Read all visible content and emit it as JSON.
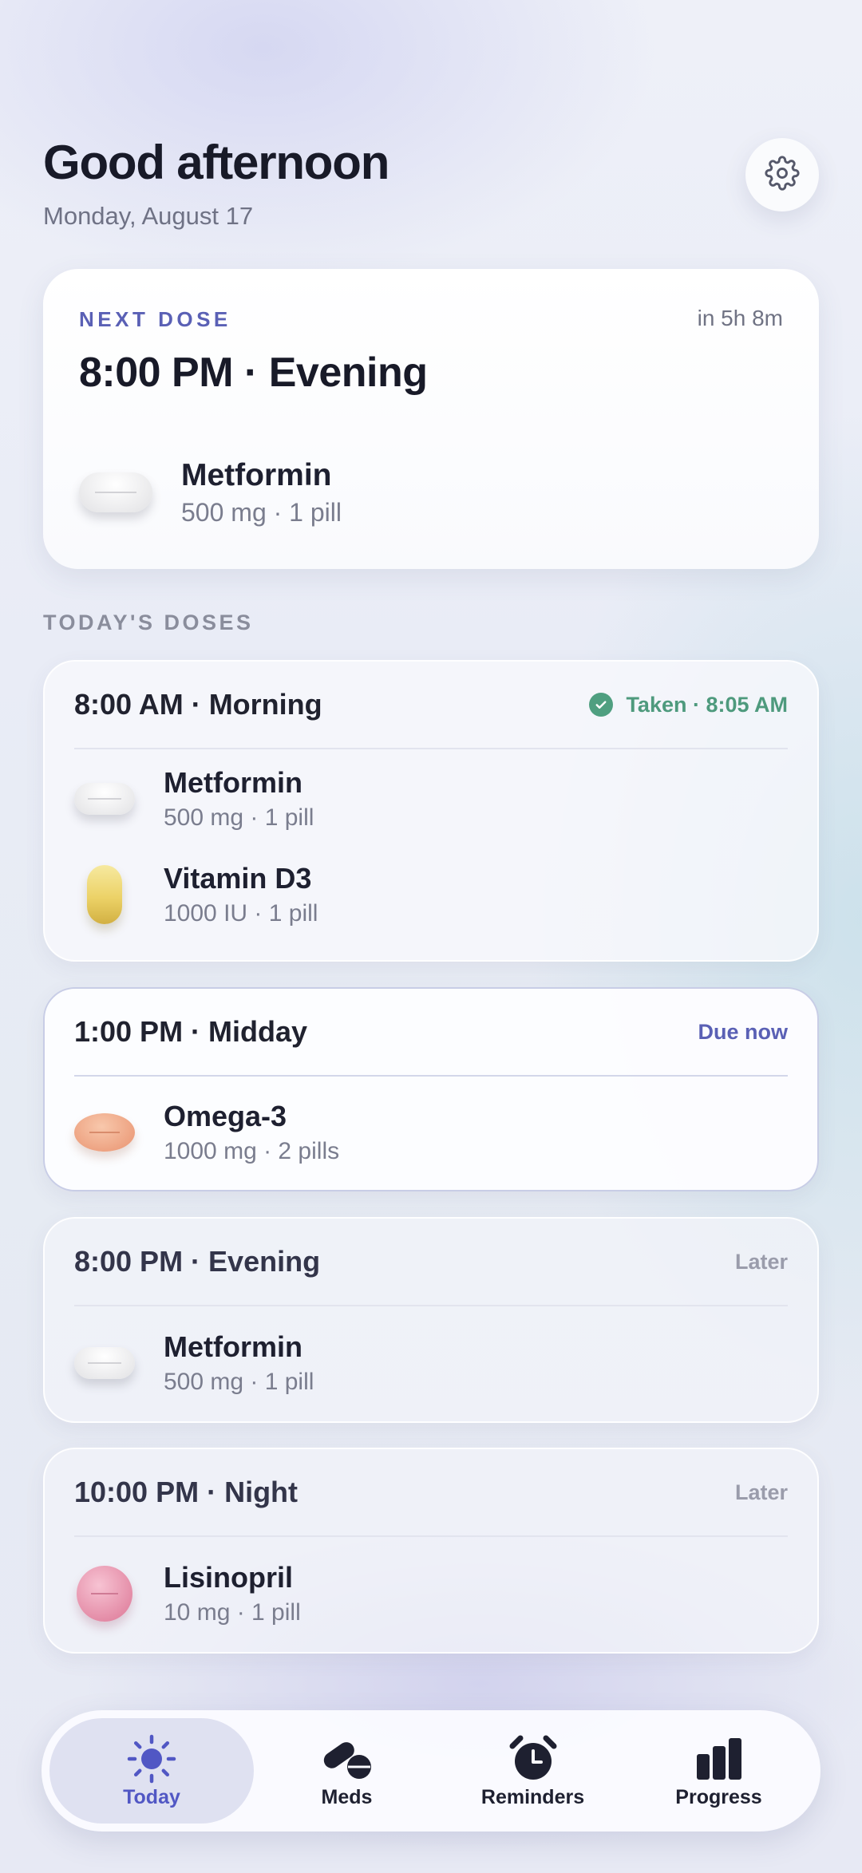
{
  "header": {
    "greeting": "Good afternoon",
    "date": "Monday, August 17"
  },
  "settings": {
    "icon": "gear-icon"
  },
  "next_dose": {
    "label": "NEXT DOSE",
    "eta": "in 5h 8m",
    "time": "8:00 PM · Evening",
    "med": {
      "name": "Metformin",
      "detail": "500 mg · 1 pill",
      "pill": "white-oval-pill"
    }
  },
  "section_title": "TODAY'S DOSES",
  "doses": [
    {
      "time": "8:00 AM · Morning",
      "status": "Taken · 8:05 AM",
      "status_color": "#4e9a7d",
      "meds": [
        {
          "name": "Metformin",
          "detail": "500 mg · 1 pill",
          "pill": "white-oval-pill"
        },
        {
          "name": "Vitamin D3",
          "detail": "1000 IU · 1 pill",
          "pill": "yellow-capsule"
        }
      ]
    },
    {
      "time": "1:00 PM · Midday",
      "status": "Due now",
      "status_color": "#5a60b5",
      "meds": [
        {
          "name": "Omega-3",
          "detail": "1000 mg · 2 pills",
          "pill": "orange-oval-pill"
        }
      ]
    },
    {
      "time": "8:00 PM · Evening",
      "status": "Later",
      "meds": [
        {
          "name": "Metformin",
          "detail": "500 mg · 1 pill",
          "pill": "white-oval-pill"
        }
      ]
    },
    {
      "time": "10:00 PM · Night",
      "status": "Later",
      "meds": [
        {
          "name": "Lisinopril",
          "detail": "10 mg · 1 pill",
          "pill": "pink-round-pill"
        }
      ]
    }
  ],
  "tabs": [
    {
      "label": "Today",
      "icon": "sun-icon",
      "active": true
    },
    {
      "label": "Meds",
      "icon": "pills-icon"
    },
    {
      "label": "Reminders",
      "icon": "alarm-clock-icon"
    },
    {
      "label": "Progress",
      "icon": "bar-chart-icon"
    }
  ],
  "colors": {
    "accent": "#5157c4",
    "taken": "#4e9a7d",
    "text": "#1c1d2b",
    "muted": "#7a7d8e"
  }
}
